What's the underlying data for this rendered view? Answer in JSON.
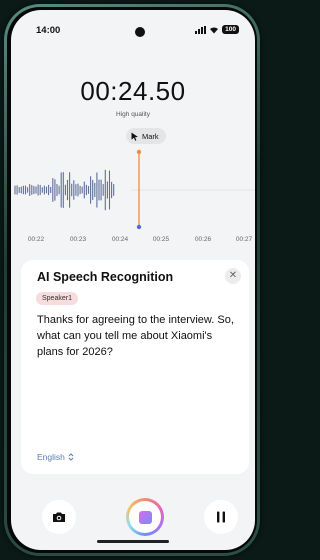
{
  "status_bar": {
    "time": "14:00",
    "battery": "100"
  },
  "recorder": {
    "elapsed": "00:24.50",
    "quality": "High quality",
    "mark_label": "Mark",
    "time_ticks": [
      "00:22",
      "00:23",
      "00:24",
      "00:25",
      "00:26",
      "00:27"
    ]
  },
  "transcription": {
    "title": "AI Speech Recognition",
    "speaker": "Speaker1",
    "text": "Thanks for agreeing to the interview. So, what can you tell me about Xiaomi's plans for 2026?",
    "language": "English"
  },
  "icons": {
    "camera": "camera-icon",
    "record": "stop-recording-icon",
    "pause": "pause-icon",
    "close": "close-icon",
    "mark": "cursor-icon"
  },
  "colors": {
    "accent_playhead": "#f08c3c",
    "language_link": "#5b7fb0",
    "speaker_badge_bg": "#f6dcdc"
  }
}
